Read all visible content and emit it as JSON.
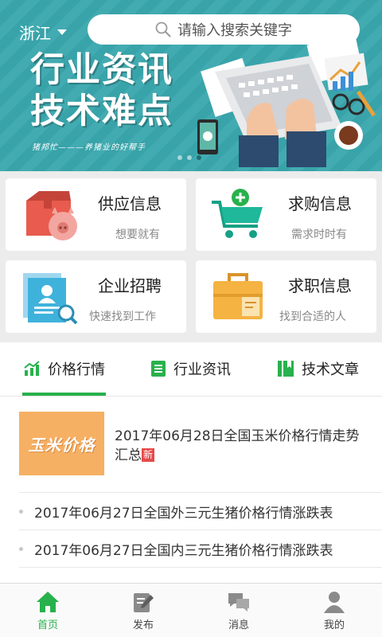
{
  "header": {
    "city": "浙江",
    "search_placeholder": "请输入搜索关键字"
  },
  "banner": {
    "title_line1": "行业资讯",
    "title_line2": "技术难点",
    "tagline": "猪邦忙———养猪业的好帮手",
    "dots_total": 3,
    "dots_active": 3
  },
  "cards": [
    {
      "title": "供应信息",
      "subtitle": "想要就有",
      "icon": "pig-box-icon"
    },
    {
      "title": "求购信息",
      "subtitle": "需求时时有",
      "icon": "shopping-cart-icon"
    },
    {
      "title": "企业招聘",
      "subtitle": "快速找到工作",
      "icon": "resume-search-icon"
    },
    {
      "title": "求职信息",
      "subtitle": "找到合适的人",
      "icon": "briefcase-icon"
    }
  ],
  "tabs": [
    {
      "label": "价格行情",
      "icon": "chart-icon",
      "active": true
    },
    {
      "label": "行业资讯",
      "icon": "document-icon",
      "active": false
    },
    {
      "label": "技术文章",
      "icon": "book-icon",
      "active": false
    }
  ],
  "news": {
    "featured_image_text": "玉米价格",
    "featured_title": "2017年06月28日全国玉米价格行情走势汇总",
    "featured_badge": "新",
    "items": [
      "2017年06月27日全国外三元生猪价格行情涨跌表",
      "2017年06月27日全国内三元生猪价格行情涨跌表"
    ]
  },
  "bottom_nav": [
    {
      "label": "首页",
      "icon": "home-icon",
      "active": true
    },
    {
      "label": "发布",
      "icon": "edit-icon",
      "active": false
    },
    {
      "label": "消息",
      "icon": "chat-icon",
      "active": false
    },
    {
      "label": "我的",
      "icon": "user-icon",
      "active": false
    }
  ],
  "colors": {
    "brand_green": "#28b14c",
    "banner_teal": "#3aa8ae",
    "badge_red": "#e64a4a",
    "card_image_orange": "#f6b063"
  }
}
